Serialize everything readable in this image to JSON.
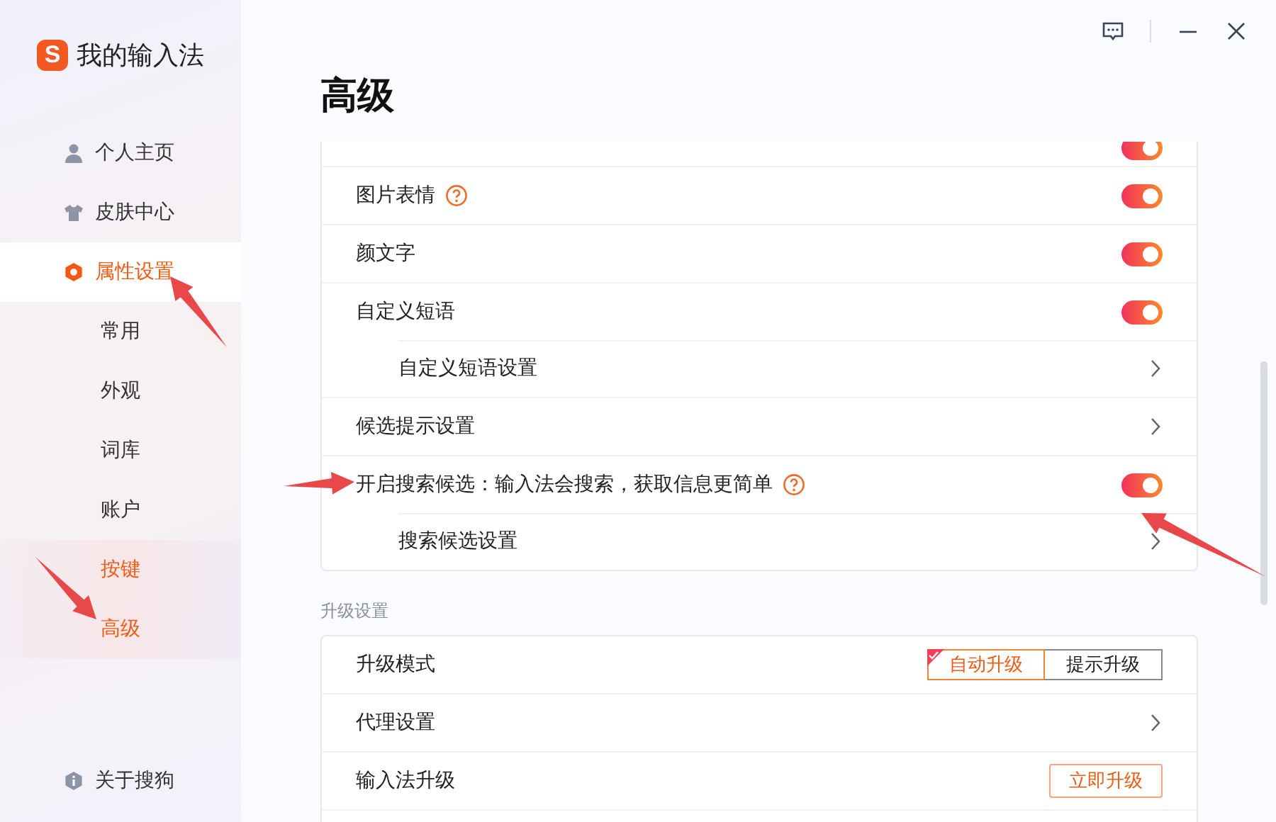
{
  "app": {
    "logo": "S",
    "title": "我的输入法"
  },
  "sidebar": {
    "items": [
      {
        "label": "个人主页",
        "sub": false,
        "selected": false
      },
      {
        "label": "皮肤中心",
        "sub": false,
        "selected": false
      },
      {
        "label": "属性设置",
        "sub": false,
        "selected": true
      },
      {
        "label": "常用",
        "sub": true,
        "selected": false
      },
      {
        "label": "外观",
        "sub": true,
        "selected": false
      },
      {
        "label": "词库",
        "sub": true,
        "selected": false
      },
      {
        "label": "账户",
        "sub": true,
        "selected": false
      },
      {
        "label": "按键",
        "sub": true,
        "selected": true
      },
      {
        "label": "高级",
        "sub": true,
        "selected": true
      }
    ],
    "footer": {
      "label": "关于搜狗"
    }
  },
  "page": {
    "title": "高级"
  },
  "sections": [
    {
      "rows": [
        {
          "kind": "toggle",
          "on": true,
          "clipped": true
        },
        {
          "kind": "toggle",
          "label": "图片表情",
          "help": true,
          "on": true
        },
        {
          "kind": "toggle",
          "label": "颜文字",
          "on": true
        },
        {
          "kind": "toggle",
          "label": "自定义短语",
          "on": true,
          "children": [
            {
              "kind": "link",
              "label": "自定义短语设置"
            }
          ]
        },
        {
          "kind": "link",
          "label": "候选提示设置"
        },
        {
          "kind": "toggle",
          "label": "开启搜索候选：输入法会搜索，获取信息更简单",
          "help": true,
          "on": true,
          "children": [
            {
              "kind": "link",
              "label": "搜索候选设置"
            }
          ]
        }
      ]
    },
    {
      "heading": "升级设置",
      "rows": [
        {
          "kind": "segmented",
          "label": "升级模式",
          "options": [
            {
              "label": "自动升级",
              "selected": true
            },
            {
              "label": "提示升级",
              "selected": false
            }
          ]
        },
        {
          "kind": "link",
          "label": "代理设置"
        },
        {
          "kind": "button",
          "label": "输入法升级",
          "button": "立即升级"
        },
        {
          "kind": "blank"
        }
      ]
    }
  ]
}
